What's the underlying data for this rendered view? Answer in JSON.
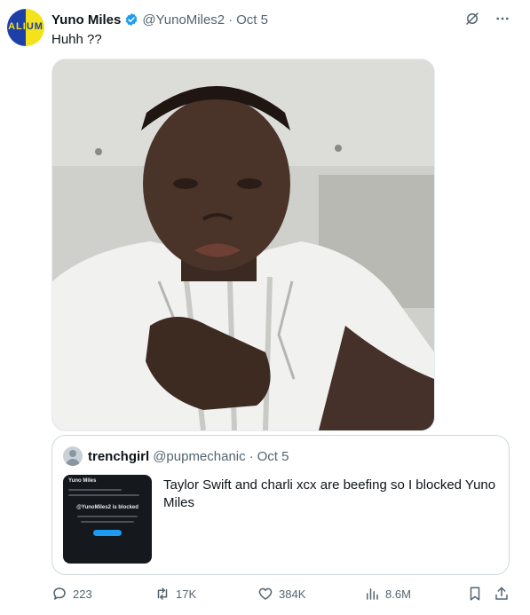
{
  "author": {
    "avatar_text_left": "ALI",
    "avatar_text_right": "UM",
    "name": "Yuno Miles",
    "handle": "@YunoMiles2",
    "separator": "·",
    "date": "Oct 5"
  },
  "tweet": {
    "text": "Huhh ??"
  },
  "icons": {
    "verified": "verified-badge-icon",
    "grok": "grok-icon",
    "more": "more-icon"
  },
  "colors": {
    "verified": "#1d9bf0",
    "secondary_text": "#536471",
    "border": "#cfd9de"
  },
  "quoted": {
    "name": "trenchgirl",
    "handle": "@pupmechanic",
    "separator": "·",
    "date": "Oct 5",
    "text": "Taylor Swift and charli xcx are beefing so I blocked Yuno Miles",
    "thumbnail": {
      "title": "Yuno Miles",
      "blocked_text": "@YunoMiles2 is blocked"
    }
  },
  "actions": {
    "replies": "223",
    "reposts": "17K",
    "likes": "384K",
    "views": "8.6M"
  }
}
